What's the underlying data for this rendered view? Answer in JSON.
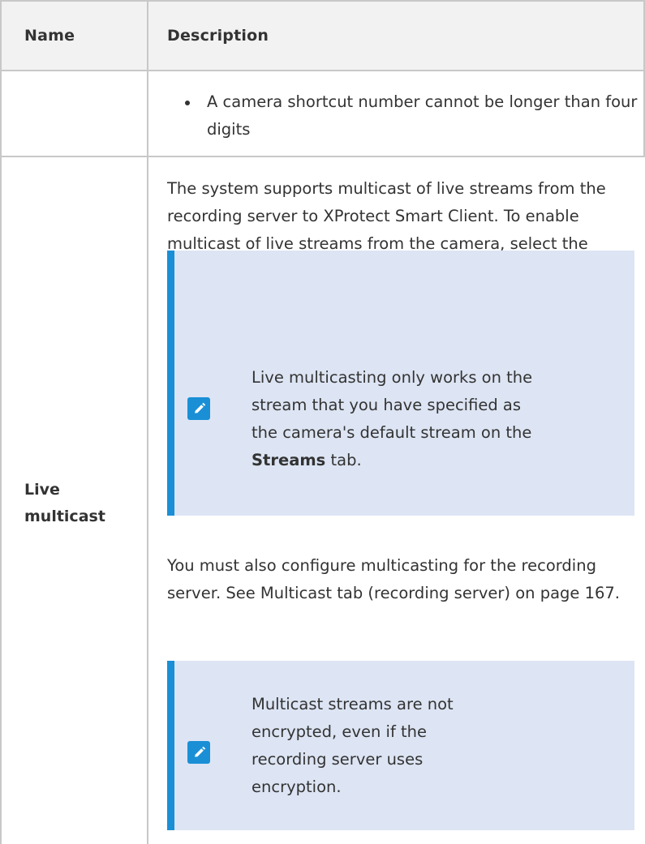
{
  "table": {
    "headers": {
      "name": "Name",
      "description": "Description"
    },
    "continued_row": {
      "bullet": "A camera shortcut number cannot be longer than four digits"
    },
    "live_multicast_row": {
      "name": "Live multicast",
      "intro": "The system supports multicast of live streams from the recording server to XProtect Smart Client. To enable multicast of live streams from the camera, select the check box.",
      "note1": {
        "icon": "pencil-icon",
        "text_before": "Live multicasting only works on the stream that you have specified as the camera's default stream on the",
        "bold": "Streams",
        "text_after": "tab."
      },
      "para2": "You must also configure multicasting for the recording server. See Multicast tab (recording server) on page 167.",
      "note2": {
        "icon": "pencil-icon",
        "text": "Multicast streams are not encrypted, even if the recording server uses encryption."
      }
    }
  },
  "colors": {
    "header_bg": "#f2f2f2",
    "note_bg": "#dde5f4",
    "note_accent": "#1a8fd6",
    "border": "#c8c8c8",
    "text": "#333333"
  }
}
